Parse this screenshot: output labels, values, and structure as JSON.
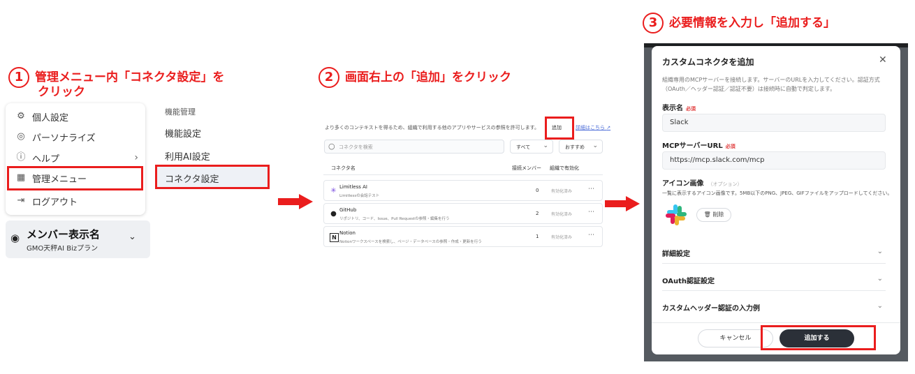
{
  "steps": [
    {
      "num": "1",
      "line1": "管理メニュー内「コネクタ設定」を",
      "line2": "クリック"
    },
    {
      "num": "2",
      "text": "画面右上の「追加」をクリック"
    },
    {
      "num": "3",
      "text": "必要情報を入力し「追加する」"
    }
  ],
  "menu": {
    "items": [
      {
        "label": "個人設定",
        "icon": "gear-icon"
      },
      {
        "label": "パーソナライズ",
        "icon": "personalize-icon"
      },
      {
        "label": "ヘルプ",
        "icon": "help-icon"
      },
      {
        "label": "管理メニュー",
        "icon": "admin-icon"
      },
      {
        "label": "ログアウト",
        "icon": "logout-icon"
      }
    ],
    "member_name": "メンバー表示名",
    "member_plan": "GMO天秤AI Bizプラン"
  },
  "submenu": {
    "heading": "機能管理",
    "items": [
      "機能設定",
      "利用AI設定",
      "コネクタ設定"
    ]
  },
  "connectors": {
    "description": "より多くのコンテキストを得るため、組織で利用する他のアプリやサービスの参照を許可します。",
    "add_label": "追加",
    "link_label": "詳細はこちら",
    "search_placeholder": "コネクタを検索",
    "filter_all": "すべて",
    "sort": "おすすめ",
    "columns": [
      "コネクタ名",
      "接続メンバー",
      "組織で有効化"
    ],
    "rows": [
      {
        "name": "Limitless AI",
        "desc": "Limitlessの会話テスト",
        "count": "0",
        "status": "有効化済み"
      },
      {
        "name": "GitHub",
        "desc": "リポジトリ、コード、Issue、Pull Requestの参照・編集を行う",
        "count": "2",
        "status": "有効化済み"
      },
      {
        "name": "Notion",
        "desc": "Notionワークスペースを検索し、ページ・データベースの参照・作成・更新を行う",
        "count": "1",
        "status": "有効化済み"
      }
    ]
  },
  "modal": {
    "title": "カスタムコネクタを追加",
    "description": "組織専用のMCPサーバーを接続します。サーバーのURLを入力してください。認証方式（OAuth／ヘッダー認証／認証不要）は接続時に自動で判定します。",
    "display_name_label": "表示名",
    "required": "必須",
    "display_name_value": "Slack",
    "url_label": "MCPサーバーURL",
    "url_value": "https://mcp.slack.com/mcp",
    "icon_label": "アイコン画像",
    "optional": "（オプション）",
    "icon_hint": "一覧に表示するアイコン画像です。5MB以下のPNG、JPEG、GIFファイルをアップロードしてください。",
    "delete_label": "削除",
    "accordions": [
      "詳細設定",
      "OAuth認証設定",
      "カスタムヘッダー認証の入力例"
    ],
    "cancel_label": "キャンセル",
    "submit_label": "追加する"
  },
  "colors": {
    "accent_red": "#ea1d1d",
    "primary_dark": "#2b3038"
  }
}
